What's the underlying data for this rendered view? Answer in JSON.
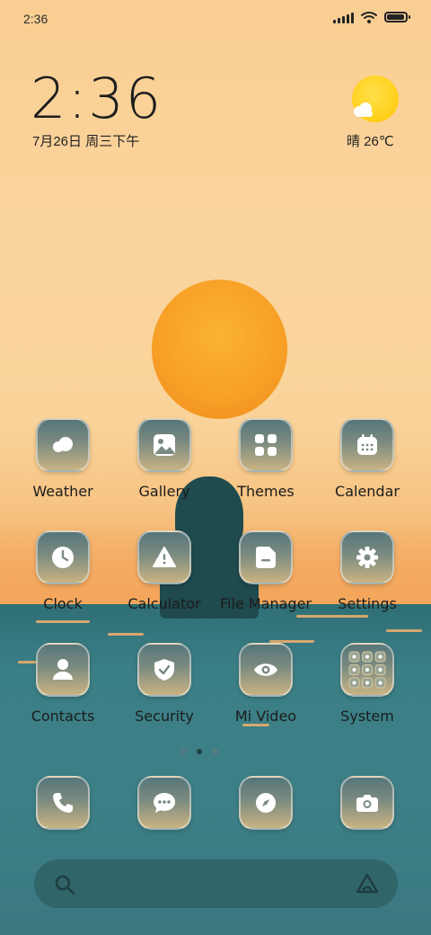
{
  "status_bar": {
    "time": "2:36",
    "battery_level": 0.95
  },
  "clock_widget": {
    "time": "2:36",
    "date": "7月26日 周三下午"
  },
  "weather_widget": {
    "text": "晴 26℃",
    "icon": "sun-with-cloud-icon"
  },
  "apps": [
    {
      "label": "Weather",
      "icon": "cloud-icon"
    },
    {
      "label": "Gallery",
      "icon": "image-icon"
    },
    {
      "label": "Themes",
      "icon": "grid-icon"
    },
    {
      "label": "Calendar",
      "icon": "calendar-icon"
    },
    {
      "label": "Clock",
      "icon": "clock-icon"
    },
    {
      "label": "Calculator",
      "icon": "warning-icon"
    },
    {
      "label": "File Manager",
      "icon": "folder-icon"
    },
    {
      "label": "Settings",
      "icon": "gear-icon"
    },
    {
      "label": "Contacts",
      "icon": "person-icon"
    },
    {
      "label": "Security",
      "icon": "shield-icon"
    },
    {
      "label": "Mi Video",
      "icon": "eye-icon"
    },
    {
      "label": "System",
      "icon": "folder-grid-icon"
    }
  ],
  "dock": [
    {
      "name": "phone",
      "icon": "phone-icon"
    },
    {
      "name": "messages",
      "icon": "chat-icon"
    },
    {
      "name": "browser",
      "icon": "compass-icon"
    },
    {
      "name": "camera",
      "icon": "camera-icon"
    }
  ],
  "pager": {
    "pages": 3,
    "active": 2
  },
  "colors": {
    "sky": "#f9ce92",
    "sun": "#f7a126",
    "sea": "#3b7f86",
    "icon_tile_top": "#56767a",
    "icon_tile_bottom": "#c9b383"
  }
}
